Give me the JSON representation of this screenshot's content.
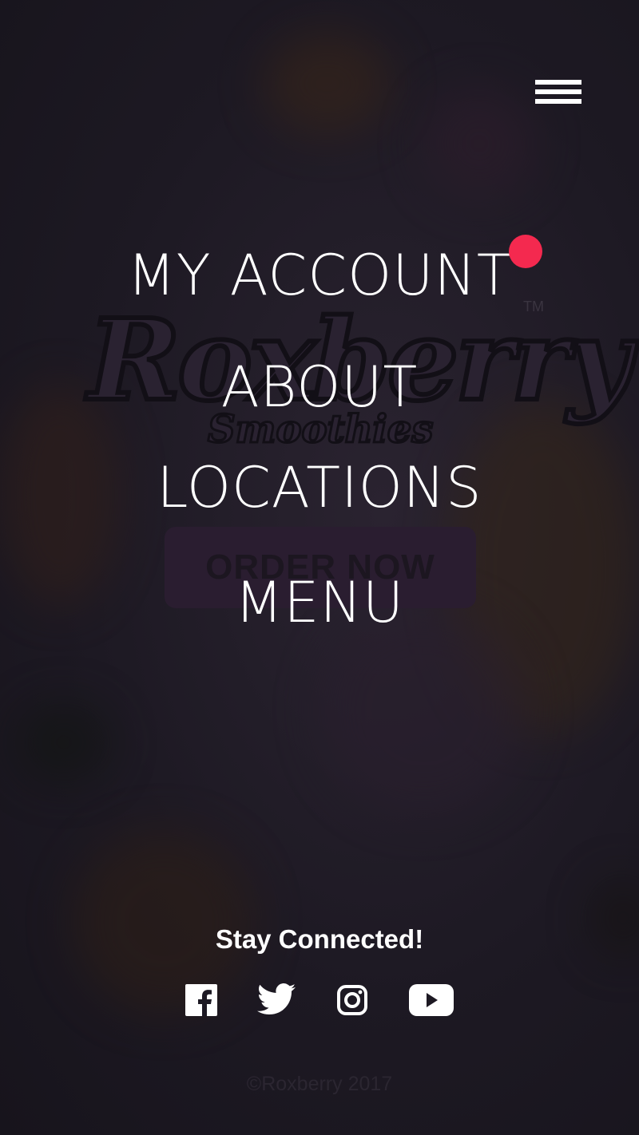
{
  "background": {
    "logo_script": "Roxberry",
    "logo_sub": "Smoothies",
    "logo_tm": "TM",
    "order_button": "ORDER NOW"
  },
  "header": {
    "menu_toggle_icon": "hamburger-icon"
  },
  "nav": {
    "items": [
      {
        "label": "MY ACCOUNT",
        "badge": "notification-dot",
        "badge_color": "#f4294f"
      },
      {
        "label": "ABOUT"
      },
      {
        "label": "LOCATIONS"
      },
      {
        "label": "MENU"
      }
    ]
  },
  "footer": {
    "stay_connected": "Stay Connected!",
    "social_icons": [
      "facebook-icon",
      "twitter-icon",
      "instagram-icon",
      "youtube-icon"
    ],
    "copyright": "©Roxberry 2017"
  },
  "colors": {
    "overlay_bg": "#1b1722",
    "accent": "#f4294f",
    "text": "#ffffff"
  }
}
